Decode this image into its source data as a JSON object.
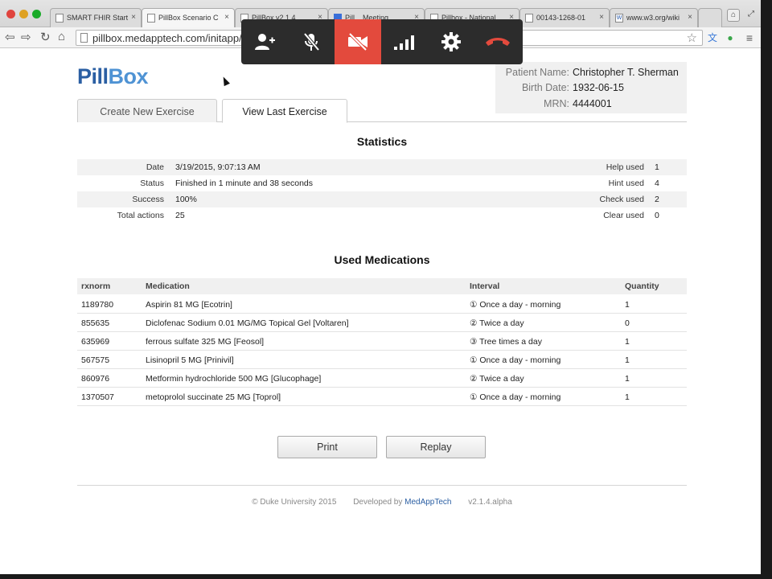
{
  "browser": {
    "tabs": [
      {
        "title": "SMART FHIR Start"
      },
      {
        "title": "PillBox Scenario C"
      },
      {
        "title": "PillBox v2.1.4"
      },
      {
        "title": "Pill... Meeting"
      },
      {
        "title": "Pillbox - National"
      },
      {
        "title": "00143-1268-01"
      },
      {
        "title": "www.w3.org/wiki"
      }
    ],
    "url": "pillbox.medapptech.com/initapp/#"
  },
  "colors": {
    "brand_dark": "#2b5fa3",
    "brand_light": "#4f93d4",
    "call_red": "#e34a3d"
  },
  "call_controls": [
    {
      "icon": "add-person-icon"
    },
    {
      "icon": "mic-muted-icon"
    },
    {
      "icon": "camera-off-icon"
    },
    {
      "icon": "signal-icon"
    },
    {
      "icon": "gear-icon"
    },
    {
      "icon": "hang-up-icon"
    }
  ],
  "app": {
    "logo_part1": "Pill",
    "logo_part2": "Box",
    "tabs": {
      "create": "Create New Exercise",
      "view": "View Last Exercise"
    }
  },
  "patient": {
    "name_label": "Patient Name:",
    "name": "Christopher T. Sherman",
    "dob_label": "Birth Date:",
    "dob": "1932-06-15",
    "mrn_label": "MRN:",
    "mrn": "4444001"
  },
  "statistics": {
    "title": "Statistics",
    "rows": [
      {
        "label": "Date",
        "value": "3/19/2015, 9:07:13 AM",
        "label2": "Help used",
        "value2": "1"
      },
      {
        "label": "Status",
        "value": "Finished in 1 minute and 38 seconds",
        "label2": "Hint used",
        "value2": "4"
      },
      {
        "label": "Success",
        "value": "100%",
        "label2": "Check used",
        "value2": "2"
      },
      {
        "label": "Total actions",
        "value": "25",
        "label2": "Clear used",
        "value2": "0"
      }
    ]
  },
  "medications": {
    "title": "Used Medications",
    "headers": {
      "rxnorm": "rxnorm",
      "medication": "Medication",
      "interval": "Interval",
      "quantity": "Quantity"
    },
    "rows": [
      {
        "rxnorm": "1189780",
        "medication": "Aspirin 81 MG [Ecotrin]",
        "interval": "① Once a day - morning",
        "quantity": "1"
      },
      {
        "rxnorm": "855635",
        "medication": "Diclofenac Sodium 0.01 MG/MG Topical Gel [Voltaren]",
        "interval": "② Twice a day",
        "quantity": "0"
      },
      {
        "rxnorm": "635969",
        "medication": "ferrous sulfate 325 MG [Feosol]",
        "interval": "③ Tree times a day",
        "quantity": "1"
      },
      {
        "rxnorm": "567575",
        "medication": "Lisinopril 5 MG [Prinivil]",
        "interval": "① Once a day - morning",
        "quantity": "1"
      },
      {
        "rxnorm": "860976",
        "medication": "Metformin hydrochloride 500 MG [Glucophage]",
        "interval": "② Twice a day",
        "quantity": "1"
      },
      {
        "rxnorm": "1370507",
        "medication": "metoprolol succinate 25 MG [Toprol]",
        "interval": "① Once a day - morning",
        "quantity": "1"
      }
    ]
  },
  "actions": {
    "print": "Print",
    "replay": "Replay"
  },
  "footer": {
    "copyright": "© Duke University 2015",
    "developed_by": "Developed by",
    "developer": "MedAppTech",
    "version": "v2.1.4.alpha"
  }
}
